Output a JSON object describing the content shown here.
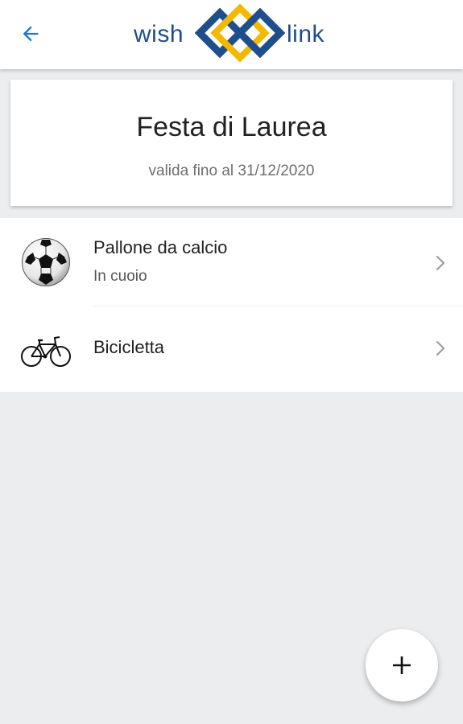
{
  "app_bar": {
    "back_icon": "arrow-left-icon",
    "logo": {
      "word_left": "wish",
      "word_right": "link",
      "icon": "interlocking-diamonds-logo",
      "colors": {
        "text": "#1F4E8C",
        "blue": "#1F4E8C",
        "gold": "#F5B800"
      }
    },
    "accent_color": "#1976D2"
  },
  "header_card": {
    "title": "Festa di Laurea",
    "subtitle": "valida fino al 31/12/2020"
  },
  "items": [
    {
      "title": "Pallone da calcio",
      "subtitle": "In cuoio",
      "icon": "soccer-ball-icon",
      "trailing_icon": "chevron-right-icon"
    },
    {
      "title": "Bicicletta",
      "icon": "bicycle-icon",
      "trailing_icon": "chevron-right-icon"
    }
  ],
  "fab": {
    "label": "+",
    "icon": "plus-icon"
  }
}
